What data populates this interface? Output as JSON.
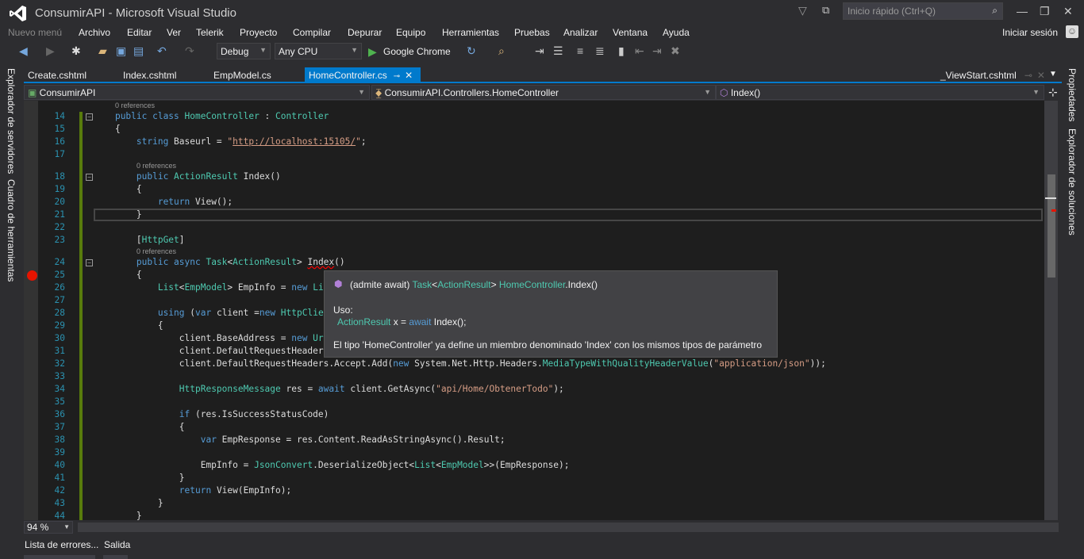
{
  "window": {
    "title": "ConsumirAPI - Microsoft Visual Studio",
    "quick_launch_placeholder": "Inicio rápido (Ctrl+Q)",
    "sign_in": "Iniciar sesión"
  },
  "menu": [
    "Nuevo menú",
    "Archivo",
    "Editar",
    "Ver",
    "Telerik",
    "Proyecto",
    "Compilar",
    "Depurar",
    "Equipo",
    "Herramientas",
    "Pruebas",
    "Analizar",
    "Ventana",
    "Ayuda"
  ],
  "toolbar": {
    "configuration": "Debug",
    "platform": "Any CPU",
    "run_target": "Google Chrome"
  },
  "tabs": [
    {
      "label": "Create.cshtml"
    },
    {
      "label": "Index.cshtml"
    },
    {
      "label": "EmpModel.cs"
    },
    {
      "label": "HomeController.cs",
      "active": true
    },
    {
      "label": "_ViewStart.cshtml"
    }
  ],
  "navbar": {
    "project": "ConsumirAPI",
    "type": "ConsumirAPI.Controllers.HomeController",
    "member": "Index()"
  },
  "side_panels": {
    "left": [
      "Explorador de servidores",
      "Cuadro de herramientas"
    ],
    "right": [
      "Propiedades",
      "Explorador de soluciones"
    ]
  },
  "codelens": "0 references",
  "code": [
    {
      "lens": true
    },
    {
      "n": "14",
      "t": [
        [
          "    ",
          "pl"
        ],
        [
          "public class ",
          "kw"
        ],
        [
          "HomeController",
          "ty"
        ],
        [
          " : ",
          "pl"
        ],
        [
          "Controller",
          "ty"
        ]
      ]
    },
    {
      "n": "15",
      "t": [
        [
          "    {",
          "pl"
        ]
      ]
    },
    {
      "n": "16",
      "t": [
        [
          "        ",
          "pl"
        ],
        [
          "string",
          "kw"
        ],
        [
          " Baseurl = ",
          "pl"
        ],
        [
          "\"",
          "st"
        ],
        [
          "http://localhost:15105/",
          "st ul"
        ],
        [
          "\"",
          "st"
        ],
        [
          ";",
          "pl"
        ]
      ]
    },
    {
      "n": "17",
      "t": []
    },
    {
      "lens": true
    },
    {
      "n": "18",
      "t": [
        [
          "        ",
          "pl"
        ],
        [
          "public ",
          "kw"
        ],
        [
          "ActionResult",
          "ty"
        ],
        [
          " Index()",
          "pl"
        ]
      ]
    },
    {
      "n": "19",
      "t": [
        [
          "        {",
          "pl"
        ]
      ]
    },
    {
      "n": "20",
      "t": [
        [
          "            ",
          "pl"
        ],
        [
          "return",
          "kw"
        ],
        [
          " View();",
          "pl"
        ]
      ]
    },
    {
      "n": "21",
      "t": [
        [
          "        }",
          "pl"
        ]
      ]
    },
    {
      "n": "22",
      "t": []
    },
    {
      "n": "23",
      "t": [
        [
          "        [",
          "pl"
        ],
        [
          "HttpGet",
          "ty"
        ],
        [
          "]",
          "pl"
        ]
      ]
    },
    {
      "lens": true
    },
    {
      "n": "24",
      "t": [
        [
          "        ",
          "pl"
        ],
        [
          "public async ",
          "kw"
        ],
        [
          "Task",
          "ty"
        ],
        [
          "<",
          "pl"
        ],
        [
          "ActionResult",
          "ty"
        ],
        [
          "> ",
          "pl"
        ],
        [
          "Index",
          "pl sq"
        ],
        [
          "()",
          "pl"
        ]
      ]
    },
    {
      "n": "25",
      "t": [
        [
          "        {",
          "pl"
        ]
      ]
    },
    {
      "n": "26",
      "t": [
        [
          "            ",
          "pl"
        ],
        [
          "List",
          "ty"
        ],
        [
          "<",
          "pl"
        ],
        [
          "EmpModel",
          "ty"
        ],
        [
          "> EmpInfo = ",
          "pl"
        ],
        [
          "new ",
          "kw"
        ],
        [
          "List",
          "ty"
        ]
      ]
    },
    {
      "n": "27",
      "t": []
    },
    {
      "n": "28",
      "t": [
        [
          "            ",
          "pl"
        ],
        [
          "using",
          "kw"
        ],
        [
          " (",
          "pl"
        ],
        [
          "var",
          "kw"
        ],
        [
          " client =",
          "pl"
        ],
        [
          "new ",
          "kw"
        ],
        [
          "HttpClient",
          "ty"
        ]
      ]
    },
    {
      "n": "29",
      "t": [
        [
          "            {",
          "pl"
        ]
      ]
    },
    {
      "n": "30",
      "t": [
        [
          "                client.BaseAddress = ",
          "pl"
        ],
        [
          "new ",
          "kw"
        ],
        [
          "Uri",
          "ty"
        ]
      ]
    },
    {
      "n": "31",
      "t": [
        [
          "                client.DefaultRequestHeaders",
          "pl"
        ]
      ]
    },
    {
      "n": "32",
      "t": [
        [
          "                client.DefaultRequestHeaders.Accept.Add(",
          "pl"
        ],
        [
          "new ",
          "kw"
        ],
        [
          "System.Net.Http.Headers.",
          "pl"
        ],
        [
          "MediaTypeWithQualityHeaderValue",
          "ty"
        ],
        [
          "(",
          "pl"
        ],
        [
          "\"application/json\"",
          "st"
        ],
        [
          "));",
          "pl"
        ]
      ]
    },
    {
      "n": "33",
      "t": []
    },
    {
      "n": "34",
      "t": [
        [
          "                ",
          "pl"
        ],
        [
          "HttpResponseMessage",
          "ty"
        ],
        [
          " res = ",
          "pl"
        ],
        [
          "await",
          "kw"
        ],
        [
          " client.GetAsync(",
          "pl"
        ],
        [
          "\"api/Home/ObtenerTodo\"",
          "st"
        ],
        [
          ");",
          "pl"
        ]
      ]
    },
    {
      "n": "35",
      "t": []
    },
    {
      "n": "36",
      "t": [
        [
          "                ",
          "pl"
        ],
        [
          "if",
          "kw"
        ],
        [
          " (res.IsSuccessStatusCode)",
          "pl"
        ]
      ]
    },
    {
      "n": "37",
      "t": [
        [
          "                {",
          "pl"
        ]
      ]
    },
    {
      "n": "38",
      "t": [
        [
          "                    ",
          "pl"
        ],
        [
          "var",
          "kw"
        ],
        [
          " EmpResponse = res.Content.ReadAsStringAsync().Result;",
          "pl"
        ]
      ]
    },
    {
      "n": "39",
      "t": []
    },
    {
      "n": "40",
      "t": [
        [
          "                    EmpInfo = ",
          "pl"
        ],
        [
          "JsonConvert",
          "ty"
        ],
        [
          ".DeserializeObject<",
          "pl"
        ],
        [
          "List",
          "ty"
        ],
        [
          "<",
          "pl"
        ],
        [
          "EmpModel",
          "ty"
        ],
        [
          ">>(EmpResponse);",
          "pl"
        ]
      ]
    },
    {
      "n": "41",
      "t": [
        [
          "                }",
          "pl"
        ]
      ]
    },
    {
      "n": "42",
      "t": [
        [
          "                ",
          "pl"
        ],
        [
          "return",
          "kw"
        ],
        [
          " View(EmpInfo);",
          "pl"
        ]
      ]
    },
    {
      "n": "43",
      "t": [
        [
          "            }",
          "pl"
        ]
      ]
    },
    {
      "n": "44",
      "t": [
        [
          "        }",
          "pl"
        ]
      ]
    }
  ],
  "tooltip": {
    "prefix": "(admite await)",
    "sig_type": "Task",
    "sig_lt": "<",
    "sig_arg": "ActionResult",
    "sig_gt": ">",
    "sig_class": "HomeController",
    "sig_method": ".Index()",
    "usage_label": "Uso:",
    "usage_type": "ActionResult",
    "usage_x": " x = ",
    "usage_await": "await",
    "usage_call": " Index();",
    "error": "El tipo 'HomeController' ya define un miembro denominado 'Index' con los mismos tipos de parámetro"
  },
  "zoom": "94 %",
  "bottom_tabs": [
    "Lista de errores...",
    "Salida"
  ]
}
